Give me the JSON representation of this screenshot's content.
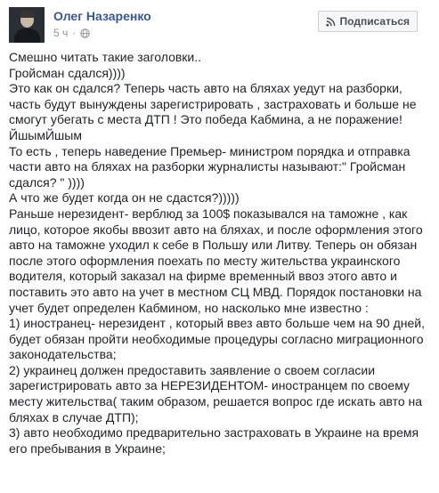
{
  "post": {
    "author": "Олег Назаренко",
    "time": "5 ч",
    "dot": "·",
    "subscribe_label": "Подписаться",
    "text": "Смешно читать такие заголовки..\nГройсман сдался))))\nЭто как он сдался? Теперь часть авто на бляхах уедут на разборки, часть будут вынуждены зарегистрировать , застраховать и больше не смогут убегать с места ДТП ! Это победа Кабмина, а не поражение! ЙшымЙшым\nТо есть , теперь наведение Премьер- министром порядка и отправка части авто на бляхах на разборки журналисты называют:\" Гройсман сдался? \" ))))\nА что же будет когда он не сдастся?)))))\nРаньше нерезидент- верблюд за 100$ показывался на таможне , как лицо, которое якобы ввозит авто на бляхах, и после оформления этого авто на таможне уходил к себе в Польшу или Литву. Теперь он обязан после этого оформления поехать по месту жительства украинского водителя, который заказал на фирме временный ввоз этого авто и поставить это авто на учет в местном СЦ МВД. Порядок постановки на учет будет определен Кабмином, но насколько мне известно :\n1) иностранец- нерезидент , который ввез авто больше чем на 90 дней, будет обязан пройти необходимые процедуры согласно миграционного законодательства;\n2) украинец должен предоставить заявление о своем согласии зарегистрировать авто за НЕРЕЗИДЕНТОМ- иностранцем по своему месту жительства( таким образом, решается вопрос где искать авто на бляхах в случае ДТП);\n3) авто необходимо предварительно застраховать в Украине на время его пребывания в Украине;"
  },
  "icons": {
    "audience": "globe-icon",
    "subscribe": "rss-icon"
  },
  "colors": {
    "author": "#365899",
    "meta": "#90949c",
    "text": "#1d2129"
  }
}
